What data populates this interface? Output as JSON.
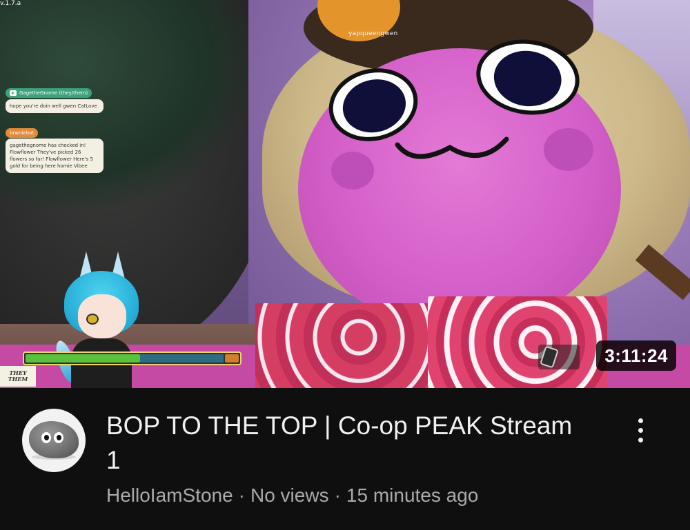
{
  "overlay": {
    "version": "v.1.7.a",
    "player_tag": "yapqueengwen"
  },
  "chat": [
    {
      "user": "GagetheGnome (they/them)",
      "message": "hope you're doin well gwen CatLove"
    },
    {
      "user": "brwniebot",
      "message": "gagethegnome has checked in! Flowflower They've picked 26 flowers so far! Flowflower Here's 5 gold for being here homie Vibee"
    }
  ],
  "badge": {
    "line1": "THEY",
    "line2": "THEM"
  },
  "health_bar": {
    "fill_fraction": 0.58
  },
  "video": {
    "duration": "3:11:24",
    "title": "BOP TO THE TOP | Co-op PEAK Stream 1",
    "channel": "HelloIamStone",
    "views": "No views",
    "age": "15 minutes ago",
    "separator": "·"
  },
  "icons": {
    "menu": "more-vert-icon",
    "chat_badge": "video-badge-icon"
  },
  "colors": {
    "background": "#0f0f0f",
    "title": "#f1f1f1",
    "secondary": "#aaaaaa",
    "face_pink": "#d45fc9"
  }
}
